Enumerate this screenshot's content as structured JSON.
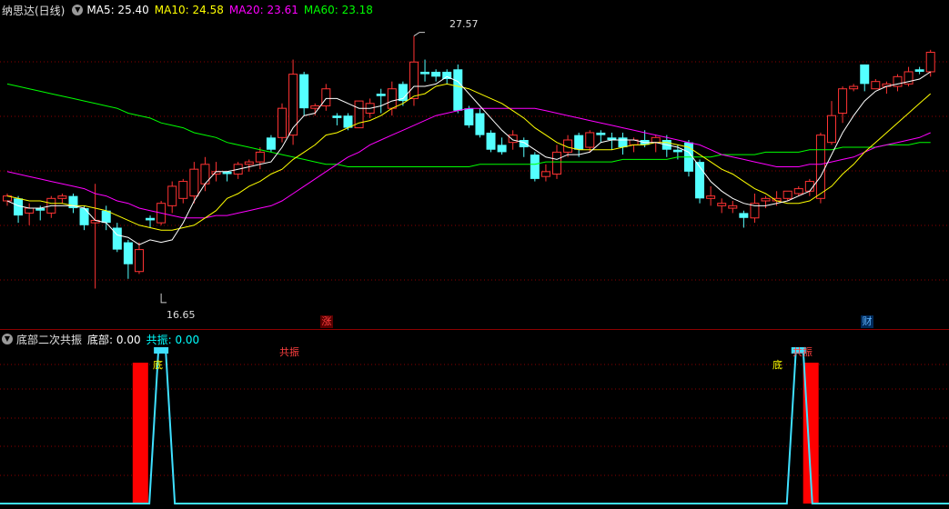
{
  "header": {
    "title": "纳思达(日线)",
    "ma": [
      {
        "label": "MA5: 25.40",
        "color": "#ffffff"
      },
      {
        "label": "MA10: 24.58",
        "color": "#ffff00"
      },
      {
        "label": "MA20: 23.61",
        "color": "#ff00ff"
      },
      {
        "label": "MA60: 23.18",
        "color": "#00ff00"
      }
    ]
  },
  "sub_header": {
    "title": "底部二次共振",
    "bottom": "底部: 0.00",
    "resonance": "共振: 0.00",
    "bottom_color": "#ffffff",
    "resonance_color": "#00ffff"
  },
  "annotations": {
    "high": "27.57",
    "low": "16.65",
    "badge_zhang": "涨",
    "badge_cai": "财",
    "sub_di": "底",
    "sub_gongzhen": "共振"
  },
  "colors": {
    "up": "#ff3333",
    "down": "#54ffff",
    "grid": "#8b0000",
    "ma5": "#ffffff",
    "ma10": "#ffff00",
    "ma20": "#ff00ff",
    "ma60": "#00ff00"
  },
  "chart_data": [
    {
      "type": "candlestick",
      "ylim": [
        15.8,
        28.3
      ],
      "candles": [
        [
          20.8,
          21.0,
          20.6,
          21.1
        ],
        [
          20.9,
          20.2,
          19.9,
          21.0
        ],
        [
          20.3,
          20.5,
          19.8,
          20.7
        ],
        [
          20.5,
          20.4,
          20.0,
          20.6
        ],
        [
          20.3,
          20.9,
          20.1,
          21.0
        ],
        [
          20.9,
          21.0,
          20.7,
          21.1
        ],
        [
          21.0,
          20.5,
          20.3,
          21.1
        ],
        [
          20.5,
          19.8,
          19.6,
          20.6
        ],
        [
          19.9,
          20.0,
          17.2,
          21.5
        ],
        [
          20.4,
          19.9,
          19.6,
          20.6
        ],
        [
          19.7,
          18.8,
          18.7,
          19.9
        ],
        [
          19.1,
          18.2,
          17.6,
          19.2
        ],
        [
          17.9,
          18.8,
          17.8,
          19.1
        ],
        [
          20.1,
          20.0,
          19.7,
          20.2
        ],
        [
          19.9,
          20.7,
          19.8,
          20.8
        ],
        [
          20.6,
          21.4,
          20.3,
          21.6
        ],
        [
          20.9,
          21.6,
          20.7,
          21.7
        ],
        [
          21.0,
          22.1,
          20.7,
          22.4
        ],
        [
          21.5,
          22.3,
          21.2,
          22.6
        ],
        [
          21.9,
          22.0,
          21.6,
          22.4
        ],
        [
          22.0,
          21.9,
          21.6,
          22.0
        ],
        [
          21.9,
          22.3,
          21.7,
          22.4
        ],
        [
          22.3,
          22.4,
          22.0,
          22.5
        ],
        [
          22.4,
          22.8,
          22.1,
          23.0
        ],
        [
          23.4,
          22.9,
          22.8,
          23.5
        ],
        [
          23.4,
          24.6,
          23.2,
          24.8
        ],
        [
          23.5,
          26.0,
          23.1,
          26.6
        ],
        [
          26.0,
          24.6,
          24.3,
          26.1
        ],
        [
          24.6,
          24.7,
          24.3,
          24.8
        ],
        [
          24.7,
          25.4,
          24.5,
          25.6
        ],
        [
          24.3,
          24.2,
          23.9,
          24.4
        ],
        [
          24.3,
          23.8,
          23.7,
          24.4
        ],
        [
          23.8,
          24.9,
          23.8,
          24.9
        ],
        [
          24.4,
          24.8,
          24.2,
          25.0
        ],
        [
          25.2,
          25.1,
          24.4,
          25.4
        ],
        [
          24.6,
          25.4,
          24.3,
          25.7
        ],
        [
          25.6,
          24.9,
          24.7,
          25.7
        ],
        [
          25.0,
          26.5,
          24.7,
          27.57
        ],
        [
          26.1,
          26.0,
          25.7,
          26.6
        ],
        [
          26.1,
          25.9,
          25.7,
          26.2
        ],
        [
          26.1,
          25.8,
          25.6,
          26.2
        ],
        [
          26.2,
          24.5,
          24.4,
          26.4
        ],
        [
          24.6,
          23.9,
          23.8,
          24.7
        ],
        [
          24.4,
          23.5,
          23.4,
          24.6
        ],
        [
          23.6,
          22.9,
          22.8,
          23.7
        ],
        [
          23.1,
          22.8,
          22.7,
          23.4
        ],
        [
          23.2,
          23.5,
          22.9,
          23.7
        ],
        [
          23.3,
          23.0,
          22.6,
          23.4
        ],
        [
          22.7,
          21.7,
          21.6,
          22.8
        ],
        [
          21.8,
          22.0,
          21.6,
          22.3
        ],
        [
          21.9,
          22.8,
          21.7,
          23.1
        ],
        [
          22.8,
          23.3,
          22.6,
          23.5
        ],
        [
          23.5,
          22.9,
          22.6,
          23.6
        ],
        [
          23.0,
          23.6,
          22.8,
          23.7
        ],
        [
          23.6,
          23.5,
          23.2,
          23.7
        ],
        [
          23.4,
          23.3,
          22.9,
          23.6
        ],
        [
          23.4,
          23.0,
          22.7,
          23.6
        ],
        [
          23.1,
          23.3,
          22.8,
          23.4
        ],
        [
          23.3,
          23.1,
          23.0,
          23.7
        ],
        [
          23.2,
          23.4,
          22.8,
          23.5
        ],
        [
          23.3,
          22.9,
          22.6,
          23.5
        ],
        [
          22.9,
          22.8,
          22.5,
          23.1
        ],
        [
          23.2,
          22.0,
          21.8,
          23.3
        ],
        [
          22.4,
          20.9,
          20.7,
          22.5
        ],
        [
          20.9,
          21.0,
          20.6,
          21.4
        ],
        [
          20.6,
          20.7,
          20.3,
          20.9
        ],
        [
          20.5,
          20.6,
          20.3,
          20.8
        ],
        [
          20.3,
          20.1,
          19.7,
          20.4
        ],
        [
          20.1,
          20.7,
          19.9,
          21.1
        ],
        [
          20.8,
          20.9,
          20.5,
          21.0
        ],
        [
          20.8,
          20.9,
          20.6,
          21.2
        ],
        [
          20.9,
          21.2,
          20.8,
          21.2
        ],
        [
          21.1,
          21.3,
          21.0,
          21.4
        ],
        [
          21.2,
          21.6,
          21.0,
          21.7
        ],
        [
          20.9,
          23.5,
          20.7,
          23.6
        ],
        [
          23.2,
          24.3,
          23.1,
          24.9
        ],
        [
          24.4,
          25.4,
          24.0,
          25.5
        ],
        [
          25.4,
          25.5,
          25.3,
          25.6
        ],
        [
          26.4,
          25.6,
          25.3,
          26.4
        ],
        [
          25.4,
          25.7,
          25.4,
          25.8
        ],
        [
          25.5,
          25.6,
          25.2,
          25.7
        ],
        [
          25.5,
          25.9,
          25.3,
          26.0
        ],
        [
          25.6,
          26.1,
          25.5,
          26.3
        ],
        [
          26.2,
          26.1,
          26.0,
          26.3
        ],
        [
          26.1,
          26.9,
          25.9,
          27.0
        ]
      ],
      "ma5": [
        20.8,
        20.6,
        20.5,
        20.5,
        20.6,
        20.6,
        20.6,
        20.5,
        20.0,
        19.9,
        19.4,
        19.3,
        19.0,
        19.2,
        19.1,
        19.2,
        19.9,
        20.8,
        21.5,
        22.0,
        22.0,
        22.1,
        22.2,
        22.3,
        22.4,
        23.0,
        23.8,
        24.3,
        24.4,
        25.0,
        25.0,
        24.8,
        24.6,
        24.6,
        24.7,
        24.9,
        25.0,
        25.5,
        25.5,
        25.6,
        25.9,
        25.7,
        25.2,
        24.7,
        24.2,
        23.7,
        23.3,
        23.2,
        22.9,
        22.6,
        22.5,
        22.7,
        22.7,
        22.8,
        23.2,
        23.3,
        23.3,
        23.3,
        23.2,
        23.2,
        23.1,
        23.0,
        22.8,
        22.2,
        21.6,
        21.2,
        20.9,
        20.7,
        20.6,
        20.6,
        20.7,
        20.8,
        21.0,
        21.2,
        21.8,
        22.7,
        23.6,
        24.3,
        24.9,
        25.3,
        25.5,
        25.6,
        25.7,
        25.8,
        26.1
      ],
      "ma10": [
        21.0,
        20.9,
        20.8,
        20.8,
        20.7,
        20.7,
        20.6,
        20.6,
        20.5,
        20.4,
        20.2,
        20.0,
        19.8,
        19.7,
        19.6,
        19.6,
        19.7,
        19.8,
        20.1,
        20.4,
        20.9,
        21.1,
        21.4,
        21.6,
        21.9,
        22.1,
        22.5,
        22.8,
        23.1,
        23.5,
        23.6,
        23.8,
        24.0,
        24.1,
        24.3,
        24.6,
        24.8,
        25.1,
        25.2,
        25.5,
        25.6,
        25.5,
        25.4,
        25.2,
        25.0,
        24.8,
        24.5,
        24.2,
        23.8,
        23.5,
        23.2,
        23.0,
        22.9,
        22.9,
        22.9,
        22.9,
        23.0,
        23.1,
        23.1,
        23.2,
        23.2,
        23.1,
        23.0,
        22.7,
        22.4,
        22.1,
        21.9,
        21.6,
        21.3,
        21.1,
        20.8,
        20.7,
        20.7,
        20.8,
        21.1,
        21.4,
        21.9,
        22.3,
        22.8,
        23.2,
        23.6,
        24.0,
        24.4,
        24.8,
        25.2
      ],
      "ma20": [
        22.0,
        21.9,
        21.8,
        21.7,
        21.6,
        21.5,
        21.4,
        21.3,
        21.1,
        21.0,
        20.8,
        20.7,
        20.5,
        20.4,
        20.3,
        20.2,
        20.1,
        20.1,
        20.1,
        20.2,
        20.2,
        20.3,
        20.4,
        20.5,
        20.6,
        20.8,
        21.1,
        21.4,
        21.7,
        22.0,
        22.3,
        22.6,
        22.8,
        23.1,
        23.3,
        23.5,
        23.7,
        23.9,
        24.1,
        24.3,
        24.4,
        24.5,
        24.6,
        24.6,
        24.6,
        24.6,
        24.6,
        24.6,
        24.6,
        24.5,
        24.4,
        24.3,
        24.2,
        24.1,
        24.0,
        23.9,
        23.8,
        23.7,
        23.6,
        23.5,
        23.4,
        23.3,
        23.2,
        23.1,
        22.9,
        22.7,
        22.6,
        22.5,
        22.4,
        22.3,
        22.2,
        22.2,
        22.2,
        22.3,
        22.3,
        22.4,
        22.5,
        22.6,
        22.8,
        23.0,
        23.1,
        23.2,
        23.3,
        23.4,
        23.6
      ],
      "ma60": [
        25.6,
        25.5,
        25.4,
        25.3,
        25.2,
        25.1,
        25.0,
        24.9,
        24.8,
        24.7,
        24.6,
        24.4,
        24.3,
        24.2,
        24.0,
        23.9,
        23.8,
        23.6,
        23.5,
        23.4,
        23.2,
        23.1,
        23.0,
        22.9,
        22.8,
        22.7,
        22.6,
        22.5,
        22.4,
        22.3,
        22.3,
        22.2,
        22.2,
        22.2,
        22.2,
        22.2,
        22.2,
        22.2,
        22.2,
        22.2,
        22.2,
        22.2,
        22.2,
        22.3,
        22.3,
        22.3,
        22.3,
        22.3,
        22.3,
        22.4,
        22.4,
        22.4,
        22.4,
        22.4,
        22.4,
        22.4,
        22.5,
        22.5,
        22.5,
        22.5,
        22.5,
        22.6,
        22.6,
        22.6,
        22.6,
        22.7,
        22.7,
        22.7,
        22.7,
        22.8,
        22.8,
        22.8,
        22.8,
        22.9,
        22.9,
        22.9,
        23.0,
        23.0,
        23.0,
        23.0,
        23.1,
        23.1,
        23.1,
        23.2,
        23.2
      ]
    },
    {
      "type": "indicator",
      "series": [
        {
          "name": "底部",
          "bars": [
            {
              "index": 10,
              "value": 1
            },
            {
              "index": 71,
              "value": 1
            }
          ]
        },
        {
          "name": "共振",
          "peaks": [
            {
              "index": 14,
              "value": 1
            },
            {
              "index": 72,
              "value": 1
            }
          ]
        }
      ]
    }
  ]
}
